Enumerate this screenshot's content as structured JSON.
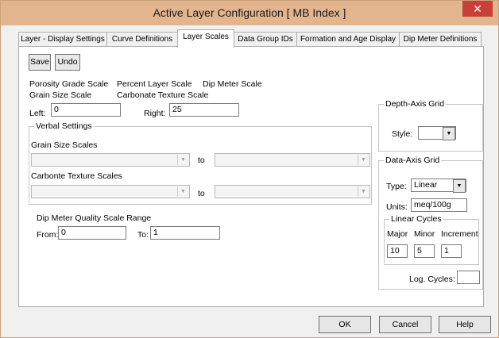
{
  "window": {
    "title": "Active Layer Configuration   [ MB Index ]",
    "close_glyph": "✕"
  },
  "tabs": [
    {
      "label": "Layer - Display Settings"
    },
    {
      "label": "Curve Definitions"
    },
    {
      "label": "Layer Scales"
    },
    {
      "label": "Data Group IDs"
    },
    {
      "label": "Formation and Age Display"
    },
    {
      "label": "Dip Meter Definitions"
    }
  ],
  "toolbar": {
    "save_label": "Save",
    "undo_label": "Undo"
  },
  "scale_types": {
    "porosity": "Porosity Grade Scale",
    "percent": "Percent Layer Scale",
    "dip_meter": "Dip Meter Scale",
    "grain_size": "Grain Size Scale",
    "carbonate": "Carbonate Texture Scale"
  },
  "range": {
    "left_label": "Left:",
    "left_value": "0",
    "right_label": "Right:",
    "right_value": "25"
  },
  "verbal": {
    "legend": "Verbal Settings",
    "grain_label": "Grain Size Scales",
    "carbonate_label": "Carbonte Texture Scales",
    "to_label": "to"
  },
  "dip_quality": {
    "label": "Dip Meter Quality Scale Range",
    "from_label": "From:",
    "from_value": "0",
    "to_label": "To:",
    "to_value": "1"
  },
  "depth_axis": {
    "legend": "Depth-Axis Grid",
    "style_label": "Style:",
    "style_value": ""
  },
  "data_axis": {
    "legend": "Data-Axis Grid",
    "type_label": "Type:",
    "type_value": "Linear",
    "units_label": "Units:",
    "units_value": "meq/100g",
    "cycles_legend": "Linear Cycles",
    "major_label": "Major",
    "minor_label": "Minor",
    "increment_label": "Increment",
    "major_value": "10",
    "minor_value": "5",
    "increment_value": "1",
    "log_label": "Log. Cycles:",
    "log_value": ""
  },
  "footer": {
    "ok_label": "OK",
    "cancel_label": "Cancel",
    "help_label": "Help"
  },
  "colors": {
    "titlebar": "#e3b58e",
    "close": "#c7413a"
  },
  "icons": {
    "dropdown": "chevron-down-icon",
    "close": "close-icon"
  }
}
